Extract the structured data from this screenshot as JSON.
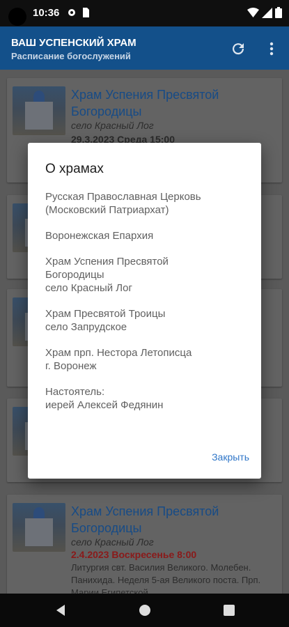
{
  "status_bar": {
    "time": "10:36",
    "icons": [
      "wifi-icon",
      "signal-icon",
      "battery-icon"
    ]
  },
  "app_bar": {
    "title": "ВАШ УСПЕНСКИЙ ХРАМ",
    "subtitle": "Расписание богослужений",
    "actions": [
      "refresh-icon",
      "more-vert-icon"
    ]
  },
  "cards": [
    {
      "title_line1": "Храм Успения Пресвятой",
      "title_line2": "Богородицы",
      "place": "село Красный Лог",
      "date": "29.3.2023  Среда 15:00"
    },
    {
      "title_line1": "Храм Успения Пресвятой",
      "title_line2": "Богородицы",
      "place": "село Красный Лог",
      "date": "2.4.2023  Воскресенье 8:00",
      "desc": "Литургия свт. Василия Великого. Молебен. Панихида. Неделя 5-ая Великого поста. Прп. Марии Египетской."
    }
  ],
  "dialog": {
    "title": "О храмах",
    "paragraphs": [
      [
        "Русская Православная Церковь",
        "(Московский Патриархат)"
      ],
      [
        "Воронежская Епархия"
      ],
      [
        "Храм Успения Пресвятой",
        "Богородицы",
        "село Красный Лог"
      ],
      [
        "Храм Пресвятой Троицы",
        "село Запрудское"
      ],
      [
        "Храм прп. Нестора Летописца",
        "г. Воронеж"
      ],
      [
        "Настоятель:",
        "иерей Алексей Федянин"
      ]
    ],
    "close_label": "Закрыть"
  },
  "nav_bar": {
    "buttons": [
      "back-icon",
      "home-icon",
      "recents-icon"
    ]
  }
}
